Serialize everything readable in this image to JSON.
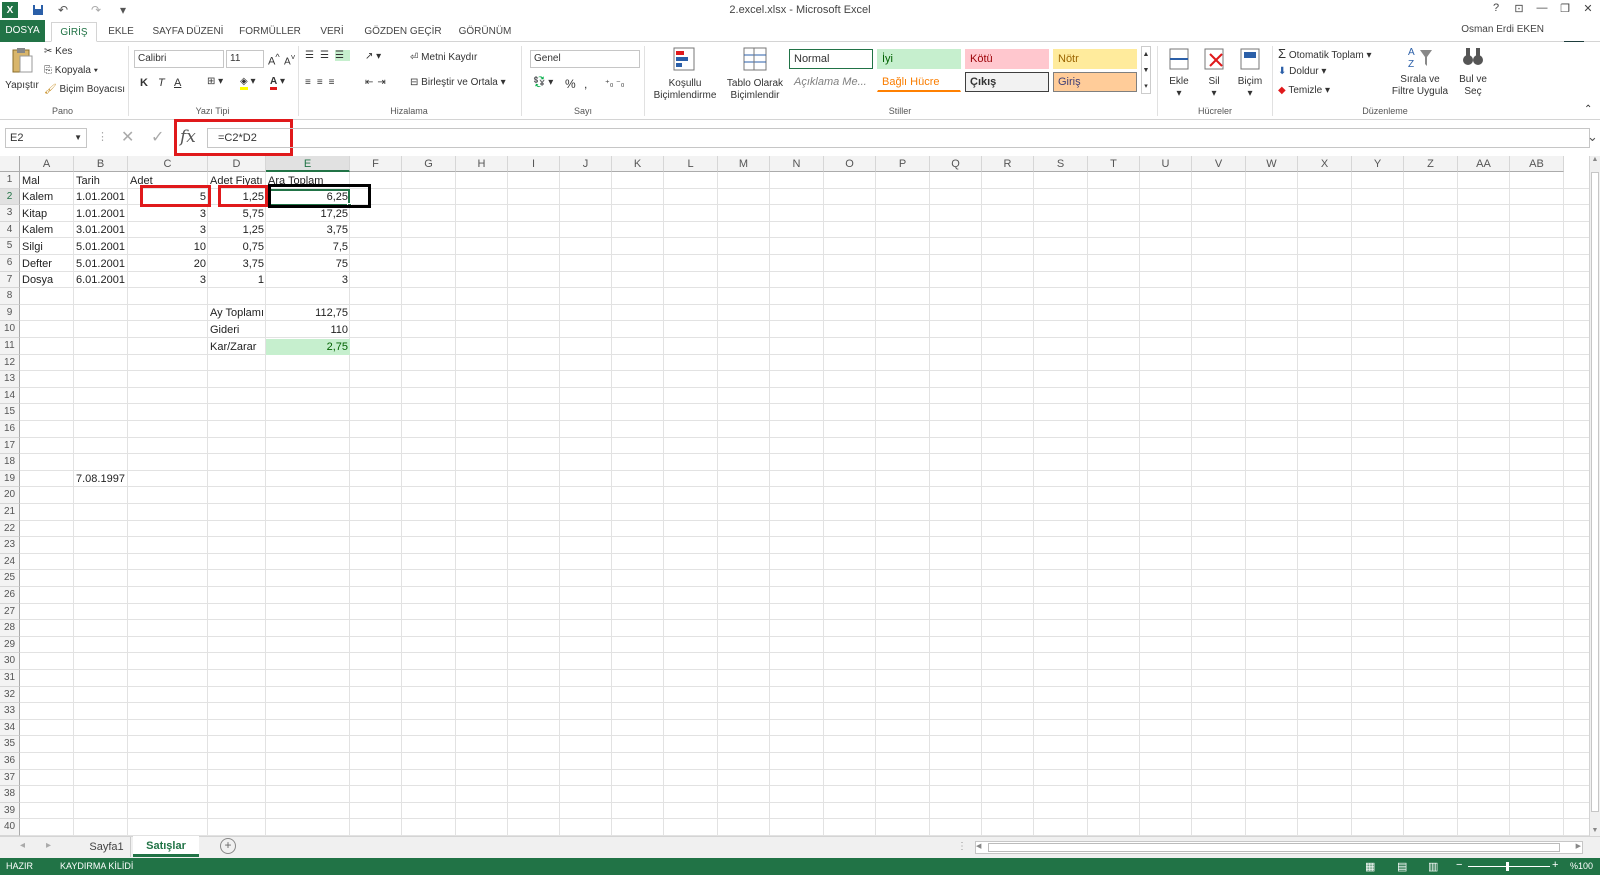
{
  "window": {
    "title": "2.excel.xlsx - Microsoft Excel",
    "help": "?",
    "min": "—",
    "max": "❐",
    "close": "✕"
  },
  "qat": {
    "excel_logo": "X",
    "save": "💾",
    "undo": "↶",
    "redo": "↷",
    "customize": "▾"
  },
  "tabs": [
    {
      "label": "DOSYA"
    },
    {
      "label": "GİRİŞ"
    },
    {
      "label": "EKLE"
    },
    {
      "label": "SAYFA DÜZENİ"
    },
    {
      "label": "FORMÜLLER"
    },
    {
      "label": "VERİ"
    },
    {
      "label": "GÖZDEN GEÇİR"
    },
    {
      "label": "GÖRÜNÜM"
    }
  ],
  "user": "Osman Erdi EKEN",
  "ribbon": {
    "pano": {
      "paste": "Yapıştır",
      "cut": "Kes",
      "copy": "Kopyala",
      "painter": "Biçim Boyacısı",
      "group": "Pano"
    },
    "font": {
      "name": "Calibri",
      "size": "11",
      "bold": "K",
      "italic": "T",
      "underline": "A",
      "group": "Yazı Tipi"
    },
    "align": {
      "wrap": "Metni Kaydır",
      "merge": "Birleştir ve Ortala",
      "group": "Hizalama"
    },
    "number": {
      "format": "Genel",
      "percent": "%",
      "comma": "000",
      "group": "Sayı"
    },
    "styles": {
      "cond": "Koşullu Biçimlendirme",
      "table": "Tablo Olarak Biçimlendir",
      "cells": [
        "Normal",
        "İyi",
        "Kötü",
        "Nötr",
        "Açıklama Me...",
        "Bağlı Hücre",
        "Çıkış",
        "Giriş"
      ],
      "group": "Stiller"
    },
    "hucreler": {
      "insert": "Ekle",
      "delete": "Sil",
      "format": "Biçim",
      "group": "Hücreler"
    },
    "duzen": {
      "autosum": "Otomatik Toplam",
      "fill": "Doldur",
      "clear": "Temizle",
      "sort": "Sırala ve Filtre Uygula",
      "find": "Bul ve Seç",
      "group": "Düzenleme"
    }
  },
  "formula_bar": {
    "name_box": "E2",
    "fx": "fx",
    "formula": "=C2*D2"
  },
  "columns": [
    "A",
    "B",
    "C",
    "D",
    "E",
    "F",
    "G",
    "H",
    "I",
    "J",
    "K",
    "L",
    "M",
    "N",
    "O",
    "P",
    "Q",
    "R",
    "S",
    "T",
    "U",
    "V",
    "W",
    "X",
    "Y",
    "Z",
    "AA",
    "AB"
  ],
  "rows": [
    "1",
    "2",
    "3",
    "4",
    "5",
    "6",
    "7",
    "8",
    "9",
    "10",
    "11",
    "12",
    "13",
    "14",
    "15",
    "16",
    "17",
    "18",
    "19",
    "20",
    "21",
    "22",
    "23",
    "24",
    "25",
    "26",
    "27",
    "28",
    "29",
    "30",
    "31",
    "32",
    "33",
    "34",
    "35",
    "36",
    "37",
    "38",
    "39",
    "40"
  ],
  "headers": {
    "A": "Mal",
    "B": "Tarih",
    "C": "Adet",
    "D": "Adet Fiyatı",
    "E": "Ara Toplam"
  },
  "table": [
    {
      "A": "Kalem",
      "B": "1.01.2001",
      "C": "5",
      "D": "1,25",
      "E": "6,25"
    },
    {
      "A": "Kitap",
      "B": "1.01.2001",
      "C": "3",
      "D": "5,75",
      "E": "17,25"
    },
    {
      "A": "Kalem",
      "B": "3.01.2001",
      "C": "3",
      "D": "1,25",
      "E": "3,75"
    },
    {
      "A": "Silgi",
      "B": "5.01.2001",
      "C": "10",
      "D": "0,75",
      "E": "7,5"
    },
    {
      "A": "Defter",
      "B": "5.01.2001",
      "C": "20",
      "D": "3,75",
      "E": "75"
    },
    {
      "A": "Dosya",
      "B": "6.01.2001",
      "C": "3",
      "D": "1",
      "E": "3"
    }
  ],
  "summary": [
    {
      "label": "Ay Toplamı",
      "value": "112,75"
    },
    {
      "label": "Gideri",
      "value": "110"
    },
    {
      "label": "Kar/Zarar",
      "value": "2,75"
    }
  ],
  "b19": "7.08.1997",
  "sheets": [
    "Sayfa1",
    "Satışlar"
  ],
  "status": {
    "ready": "HAZIR",
    "scroll": "KAYDIRMA KİLİDİ",
    "zoom": "%100"
  },
  "colors": {
    "accent": "#217346",
    "highlight_red": "#e0191b",
    "good_fill": "#c6efce"
  }
}
